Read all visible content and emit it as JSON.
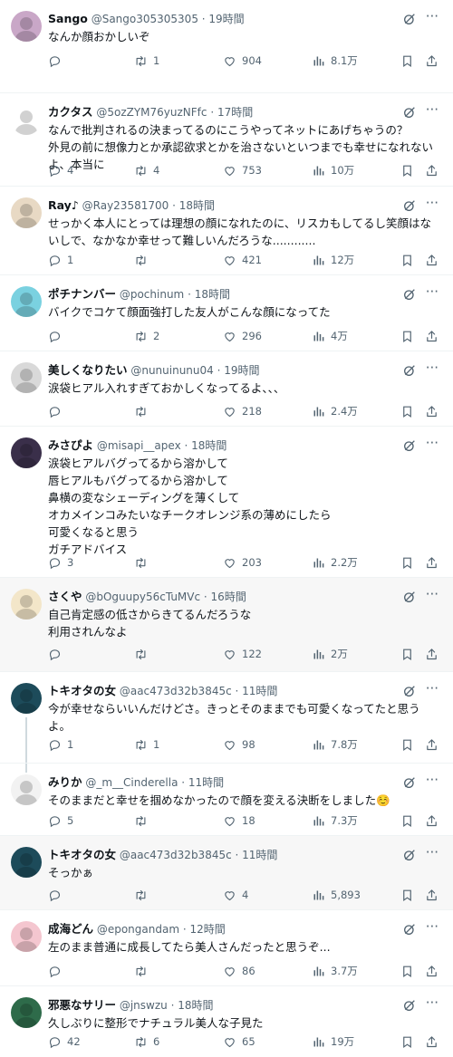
{
  "tweets": [
    {
      "name": "Sango",
      "handle": "@Sango305305305",
      "time": "19時間",
      "lines": [
        "なんか顔おかしいぞ"
      ],
      "replies": "",
      "retweets": "1",
      "likes": "904",
      "views": "8.1万",
      "avatar_color": "#c9a7c7"
    },
    {
      "name": "カクタス",
      "handle": "@5ozZYM76yuzNFfc",
      "time": "17時間",
      "lines": [
        "なんで批判されるの決まってるのにこうやってネットにあげちゃうの？",
        "外見の前に想像力とか承認欲求とかを治さないといつまでも幸せになれない",
        "よ、本当に"
      ],
      "replies": "4",
      "retweets": "4",
      "likes": "753",
      "views": "10万",
      "avatar_color": "#ffffff"
    },
    {
      "name": "Ray♪",
      "handle": "@Ray23581700",
      "time": "18時間",
      "lines": [
        "せっかく本人にとっては理想の顔になれたのに、リスカもしてるし笑顔はな",
        "いしで、なかなか幸せって難しいんだろうな............"
      ],
      "replies": "1",
      "retweets": "",
      "likes": "421",
      "views": "12万",
      "avatar_color": "#e8d9c4"
    },
    {
      "name": "ポチナンバー",
      "handle": "@pochinum",
      "time": "18時間",
      "lines": [
        "バイクでコケて顔面強打した友人がこんな顔になってた"
      ],
      "replies": "",
      "retweets": "2",
      "likes": "296",
      "views": "4万",
      "avatar_color": "#7ad1e0"
    },
    {
      "name": "美しくなりたい",
      "handle": "@nunuinunu04",
      "time": "19時間",
      "lines": [
        "涙袋ヒアル入れすぎておかしくなってるよ、、、"
      ],
      "replies": "",
      "retweets": "",
      "likes": "218",
      "views": "2.4万",
      "avatar_color": "#d9d9d9"
    },
    {
      "name": "みさぴよ",
      "handle": "@misapi__apex",
      "time": "18時間",
      "lines": [
        "涙袋ヒアルバグってるから溶かして",
        "唇ヒアルもバグってるから溶かして",
        "鼻横の変なシェーディングを薄くして",
        "オカメインコみたいなチークオレンジ系の薄めにしたら",
        "可愛くなると思う",
        "ガチアドバイス"
      ],
      "replies": "3",
      "retweets": "",
      "likes": "203",
      "views": "2.2万",
      "avatar_color": "#3a2f4a"
    },
    {
      "name": "さくや",
      "handle": "@bOguupy56cTuMVc",
      "time": "16時間",
      "lines": [
        "自己肯定感の低さからきてるんだろうな",
        "利用されんなよ"
      ],
      "replies": "",
      "retweets": "",
      "likes": "122",
      "views": "2万",
      "avatar_color": "#f3e6c9"
    },
    {
      "name": "トキオタの女",
      "handle": "@aac473d32b3845c",
      "time": "11時間",
      "lines": [
        "今が幸せならいいんだけどさ。きっとそのままでも可愛くなってたと思う",
        "よ。"
      ],
      "replies": "1",
      "retweets": "1",
      "likes": "98",
      "views": "7.8万",
      "avatar_color": "#1d4b5a"
    },
    {
      "name": "みりか",
      "handle": "@_m__Cinderella",
      "time": "11時間",
      "lines": [
        "そのままだと幸せを掴めなかったので顔を変える決断をしました☺️"
      ],
      "replies": "5",
      "retweets": "",
      "likes": "18",
      "views": "7.3万",
      "avatar_color": "#f2f2f2"
    },
    {
      "name": "トキオタの女",
      "handle": "@aac473d32b3845c",
      "time": "11時間",
      "lines": [
        "そっかぁ"
      ],
      "replies": "",
      "retweets": "",
      "likes": "4",
      "views": "5,893",
      "avatar_color": "#1d4b5a"
    },
    {
      "name": "成海どん",
      "handle": "@epongandam",
      "time": "12時間",
      "lines": [
        "左のまま普通に成長してたら美人さんだったと思うぞ..."
      ],
      "replies": "",
      "retweets": "",
      "likes": "86",
      "views": "3.7万",
      "avatar_color": "#f4c6cf"
    },
    {
      "name": "邪悪なサリー",
      "handle": "@jnswzu",
      "time": "18時間",
      "lines": [
        "久しぶりに整形でナチュラル美人な子見た"
      ],
      "replies": "42",
      "retweets": "6",
      "likes": "65",
      "views": "19万",
      "avatar_color": "#2e6b4a"
    }
  ]
}
